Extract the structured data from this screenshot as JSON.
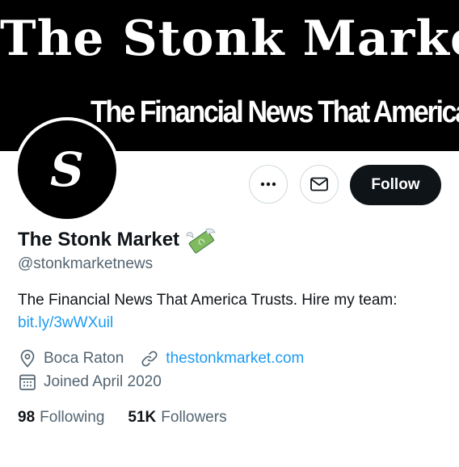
{
  "banner": {
    "title": "The Stonk Market",
    "tagline": "The Financial News That America Trusts"
  },
  "avatar": {
    "letter": "S"
  },
  "actions": {
    "follow_label": "Follow"
  },
  "profile": {
    "name": "The Stonk Market",
    "handle": "@stonkmarketnews",
    "bio": "The Financial News That America Trusts. Hire my team:",
    "bio_link": "bit.ly/3wWXuil",
    "location": "Boca Raton",
    "website": "thestonkmarket.com",
    "joined": "Joined April 2020"
  },
  "stats": {
    "following_count": "98",
    "following_label": "Following",
    "followers_count": "51K",
    "followers_label": "Followers"
  },
  "colors": {
    "accent": "#1d9bf0",
    "text": "#0f1419",
    "muted": "#536471"
  }
}
